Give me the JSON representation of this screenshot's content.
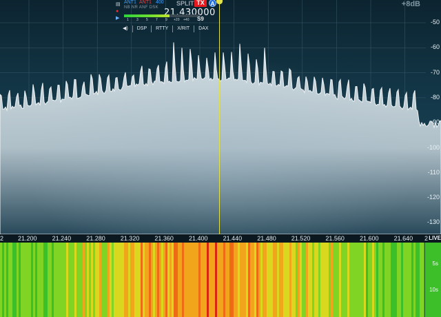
{
  "panadapter": {
    "db_readout": "+8dB",
    "db_labels": [
      "-50",
      "-60",
      "-70",
      "-80",
      "-90",
      "-100",
      "-110",
      "-120",
      "-130"
    ],
    "spectrum_color": "#c5d2d8",
    "background_color": "#14394a"
  },
  "slice": {
    "rx_antenna": "ANT1",
    "tx_antenna": "ANT1",
    "filter_width": "400",
    "mode_flags": "NB NR ANF DSK",
    "split_label": "SPLIT",
    "tx_badge": "TX",
    "slice_letter": "A",
    "frequency": "21.430000",
    "smeter_scale": [
      "1",
      "3",
      "5",
      "7",
      "9",
      "+20",
      "+40"
    ],
    "smeter_reading": "S9",
    "buttons": {
      "audio": "◀)",
      "dsp": "DSP",
      "mode": "RTTY",
      "xrit": "X/RIT",
      "dax": "DAX"
    },
    "accent_tx": "#e8191e",
    "accent_slice": "#1e6ad8",
    "center_line_color": "#e4e24a"
  },
  "freq_scale": {
    "labels": [
      "21.200",
      "21.240",
      "21.280",
      "21.320",
      "21.360",
      "21.400",
      "21.440",
      "21.480",
      "21.520",
      "21.560",
      "21.600",
      "21.640"
    ],
    "live_label": "LIVE"
  },
  "waterfall": {
    "time_labels": [
      "5s",
      "10s"
    ]
  },
  "icons": {
    "side": [
      "display-icon",
      "record-icon",
      "play-icon"
    ]
  }
}
